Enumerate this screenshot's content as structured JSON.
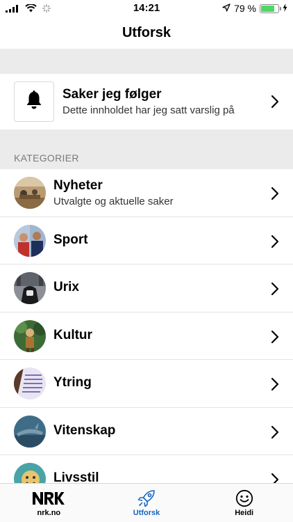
{
  "status_bar": {
    "time": "14:21",
    "battery_percent": "79 %",
    "battery_level": 0.79
  },
  "header": {
    "title": "Utforsk"
  },
  "follow": {
    "title": "Saker jeg følger",
    "subtitle": "Dette innholdet har jeg satt varslig på",
    "icon": "bell-icon"
  },
  "categories_header": "KATEGORIER",
  "categories": [
    {
      "title": "Nyheter",
      "subtitle": "Utvalgte og aktuelle saker"
    },
    {
      "title": "Sport",
      "subtitle": ""
    },
    {
      "title": "Urix",
      "subtitle": ""
    },
    {
      "title": "Kultur",
      "subtitle": ""
    },
    {
      "title": "Ytring",
      "subtitle": ""
    },
    {
      "title": "Vitenskap",
      "subtitle": ""
    },
    {
      "title": "Livsstil",
      "subtitle": ""
    }
  ],
  "tab_bar": {
    "tabs": [
      {
        "label": "nrk.no",
        "icon": "nrk-logo-icon"
      },
      {
        "label": "Utforsk",
        "icon": "rocket-icon",
        "active": true
      },
      {
        "label": "Heidi",
        "icon": "smiley-icon"
      }
    ],
    "active_color": "#1565c0"
  },
  "colors": {
    "accent": "#1565c0",
    "battery": "#4cd964",
    "section_bg": "#ebebeb"
  }
}
